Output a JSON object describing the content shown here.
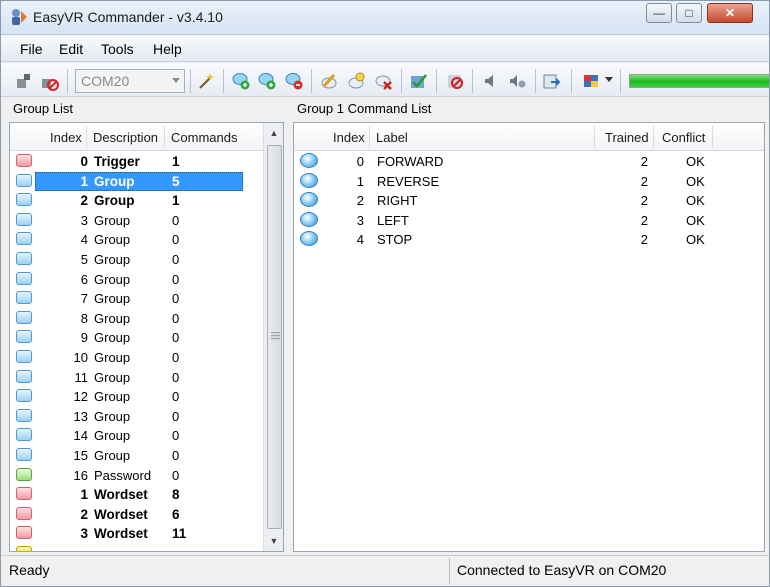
{
  "window": {
    "title": "EasyVR Commander - v3.4.10"
  },
  "menu": [
    "File",
    "Edit",
    "Tools",
    "Help"
  ],
  "toolbar": {
    "port": "COM20",
    "progress": 1.0,
    "progress_color": "#1fb91f"
  },
  "group_panel": {
    "label": "Group List",
    "columns": [
      "Index",
      "Description",
      "Commands"
    ],
    "selected_index": 1,
    "rows": [
      {
        "index": "0",
        "description": "Trigger",
        "commands": "1",
        "bold": true,
        "icon": "red-speech-bubble-icon"
      },
      {
        "index": "1",
        "description": "Group",
        "commands": "5",
        "bold": true,
        "icon": "blue-speech-bubble-icon"
      },
      {
        "index": "2",
        "description": "Group",
        "commands": "1",
        "bold": true,
        "icon": "blue-speech-bubble-icon"
      },
      {
        "index": "3",
        "description": "Group",
        "commands": "0",
        "bold": false,
        "icon": "blue-speech-bubble-icon"
      },
      {
        "index": "4",
        "description": "Group",
        "commands": "0",
        "bold": false,
        "icon": "blue-speech-bubble-icon"
      },
      {
        "index": "5",
        "description": "Group",
        "commands": "0",
        "bold": false,
        "icon": "blue-speech-bubble-icon"
      },
      {
        "index": "6",
        "description": "Group",
        "commands": "0",
        "bold": false,
        "icon": "blue-speech-bubble-icon"
      },
      {
        "index": "7",
        "description": "Group",
        "commands": "0",
        "bold": false,
        "icon": "blue-speech-bubble-icon"
      },
      {
        "index": "8",
        "description": "Group",
        "commands": "0",
        "bold": false,
        "icon": "blue-speech-bubble-icon"
      },
      {
        "index": "9",
        "description": "Group",
        "commands": "0",
        "bold": false,
        "icon": "blue-speech-bubble-icon"
      },
      {
        "index": "10",
        "description": "Group",
        "commands": "0",
        "bold": false,
        "icon": "blue-speech-bubble-icon"
      },
      {
        "index": "11",
        "description": "Group",
        "commands": "0",
        "bold": false,
        "icon": "blue-speech-bubble-icon"
      },
      {
        "index": "12",
        "description": "Group",
        "commands": "0",
        "bold": false,
        "icon": "blue-speech-bubble-icon"
      },
      {
        "index": "13",
        "description": "Group",
        "commands": "0",
        "bold": false,
        "icon": "blue-speech-bubble-icon"
      },
      {
        "index": "14",
        "description": "Group",
        "commands": "0",
        "bold": false,
        "icon": "blue-speech-bubble-icon"
      },
      {
        "index": "15",
        "description": "Group",
        "commands": "0",
        "bold": false,
        "icon": "blue-speech-bubble-icon"
      },
      {
        "index": "16",
        "description": "Password",
        "commands": "0",
        "bold": false,
        "icon": "green-speech-bubble-icon"
      },
      {
        "index": "1",
        "description": "Wordset",
        "commands": "8",
        "bold": true,
        "icon": "red-speech-bubble-icon"
      },
      {
        "index": "2",
        "description": "Wordset",
        "commands": "6",
        "bold": true,
        "icon": "red-speech-bubble-icon"
      },
      {
        "index": "3",
        "description": "Wordset",
        "commands": "11",
        "bold": true,
        "icon": "red-speech-bubble-icon"
      },
      {
        "index": "",
        "description": "",
        "commands": "",
        "bold": true,
        "icon": "yellow-speech-bubble-icon"
      }
    ]
  },
  "command_panel": {
    "label": "Group 1 Command List",
    "columns": [
      "Index",
      "Label",
      "Trained",
      "Conflict"
    ],
    "rows": [
      {
        "index": "0",
        "label": "FORWARD",
        "trained": "2",
        "conflict": "OK"
      },
      {
        "index": "1",
        "label": "REVERSE",
        "trained": "2",
        "conflict": "OK"
      },
      {
        "index": "2",
        "label": "RIGHT",
        "trained": "2",
        "conflict": "OK"
      },
      {
        "index": "3",
        "label": "LEFT",
        "trained": "2",
        "conflict": "OK"
      },
      {
        "index": "4",
        "label": "STOP",
        "trained": "2",
        "conflict": "OK"
      }
    ]
  },
  "status": {
    "left": "Ready",
    "right": "Connected to EasyVR on COM20"
  }
}
